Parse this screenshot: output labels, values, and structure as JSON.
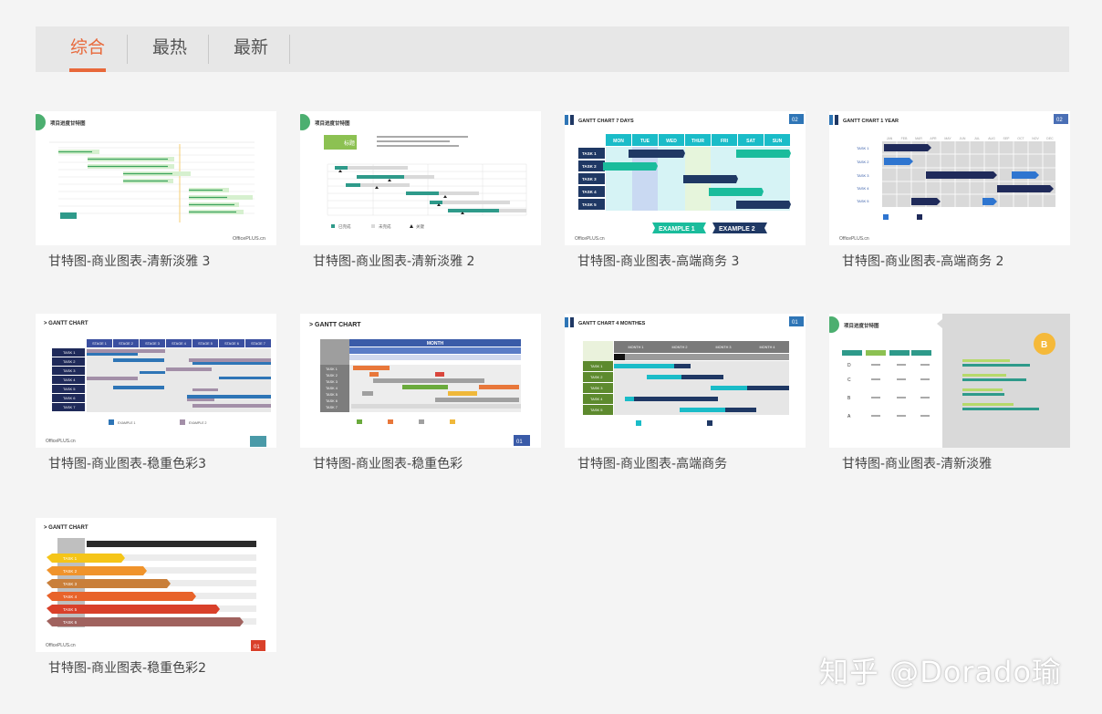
{
  "tabs": [
    {
      "label": "综合",
      "active": true
    },
    {
      "label": "最热",
      "active": false
    },
    {
      "label": "最新",
      "active": false
    }
  ],
  "cards": [
    {
      "title": "甘特图-商业图表-清新淡雅 3",
      "thumb": {
        "heading": "项目进度甘特图",
        "brand": "OfficePLUS.cn"
      }
    },
    {
      "title": "甘特图-商业图表-清新淡雅 2",
      "thumb": {
        "heading": "项目进度甘特图",
        "tag": "标题",
        "legend": [
          "已完成",
          "未完成",
          "关键"
        ]
      }
    },
    {
      "title": "甘特图-商业图表-高端商务 3",
      "thumb": {
        "heading": "GANTT CHART  7 DAYS",
        "badge": "02",
        "days": [
          "MON",
          "TUE",
          "WED",
          "THUR",
          "FRI",
          "SAT",
          "SUN"
        ],
        "tasks": [
          "TASK 1",
          "TASK 2",
          "TASK 3",
          "TASK 4",
          "TASK 5"
        ],
        "legend": [
          "EXAMPLE 1",
          "EXAMPLE 2"
        ],
        "brand": "OfficePLUS.cn"
      }
    },
    {
      "title": "甘特图-商业图表-高端商务 2",
      "thumb": {
        "heading": "GANTT CHART  1 YEAR",
        "badge": "02",
        "months": [
          "JAN",
          "FEB",
          "MAR",
          "APR",
          "MAY",
          "JUN",
          "JUL",
          "AUG",
          "SEP",
          "OCT",
          "NOV",
          "DEC"
        ],
        "tasks": [
          "TASK 1",
          "TASK 2",
          "TASK 3",
          "TASK 4",
          "TASK 5"
        ],
        "brand": "OfficePLUS.cn"
      }
    },
    {
      "title": "甘特图-商业图表-稳重色彩3",
      "thumb": {
        "heading": "> GANTT CHART",
        "stages": [
          "STAGE 1",
          "STAGE 2",
          "STAGE 3",
          "STAGE 4",
          "STAGE 5",
          "STAGE 6",
          "STAGE 7"
        ],
        "tasks": [
          "TASK 1",
          "TASK 2",
          "TASK 3",
          "TASK 4",
          "TASK 5",
          "TASK 6",
          "TASK 7"
        ],
        "legend": [
          "EXAMPLE 1",
          "EXAMPLE 2"
        ],
        "brand": "OfficePLUS.cn"
      }
    },
    {
      "title": "甘特图-商业图表-稳重色彩",
      "thumb": {
        "heading": "> GANTT CHART",
        "month": "MONTH",
        "tasks": [
          "TASK 1",
          "TASK 2",
          "TASK 3",
          "TASK 4",
          "TASK 5",
          "TASK 6",
          "TASK 7"
        ],
        "badge": "01"
      }
    },
    {
      "title": "甘特图-商业图表-高端商务",
      "thumb": {
        "heading": "GANTT CHART  4 MONTHES",
        "badge": "01",
        "months": [
          "MONTH 1",
          "MONTH 2",
          "MONTH 3",
          "MONTH 4"
        ],
        "tasks": [
          "TASK 1",
          "TASK 2",
          "TASK 3",
          "TASK 4",
          "TASK 5"
        ]
      }
    },
    {
      "title": "甘特图-商业图表-清新淡雅",
      "thumb": {
        "heading": "项目进度甘特图",
        "rows": [
          "D",
          "C",
          "B",
          "A"
        ],
        "circle": "B"
      }
    },
    {
      "title": "甘特图-商业图表-稳重色彩2",
      "thumb": {
        "heading": "> GANTT CHART",
        "tasks": [
          "TASK 1",
          "TASK 2",
          "TASK 3",
          "TASK 4",
          "TASK 5",
          "TASK 6"
        ],
        "badge": "01",
        "brand": "OfficePLUS.cn"
      }
    }
  ],
  "watermark": "知乎 @Dorado瑜",
  "colors": {
    "accent": "#e8683a",
    "navy": "#1f3864",
    "teal": "#1abc9c",
    "green": "#70ad47",
    "blue": "#2e75b6"
  }
}
